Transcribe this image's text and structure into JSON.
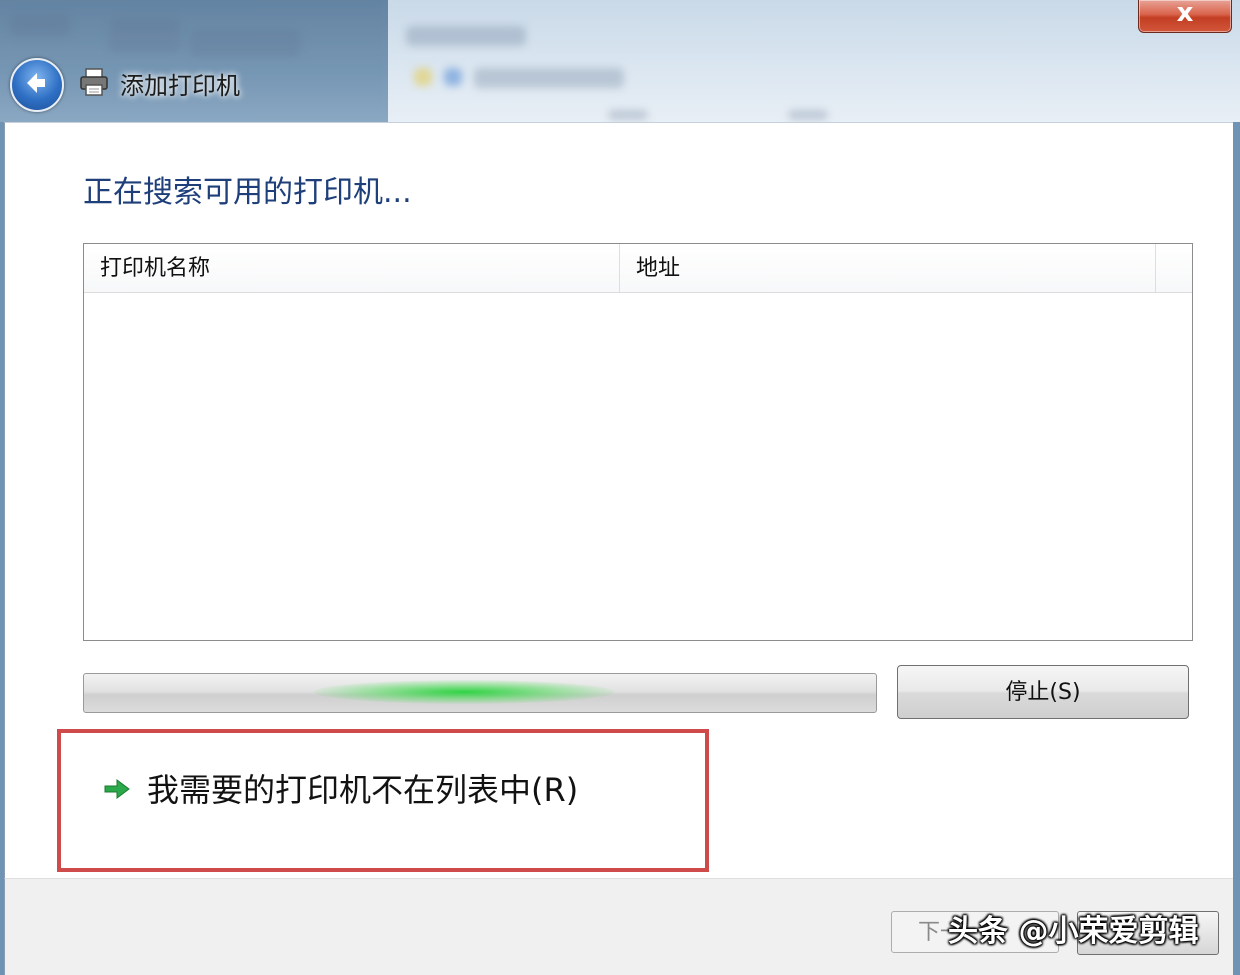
{
  "window": {
    "title": "添加打印机",
    "close_label": "x"
  },
  "main": {
    "heading": "正在搜索可用的打印机...",
    "list": {
      "columns": [
        "打印机名称",
        "地址"
      ],
      "rows": []
    },
    "progress": {
      "state": "indeterminate"
    },
    "stop_button": "停止(S)",
    "not_listed_link": "我需要的打印机不在列表中(R)",
    "highlight_color": "#cf4a4a"
  },
  "footer": {
    "next_button_partial": "下一"
  },
  "watermark": "头条 @小荣爱剪辑",
  "colors": {
    "heading": "#1e3f7a",
    "progress_green": "#28d23c"
  }
}
